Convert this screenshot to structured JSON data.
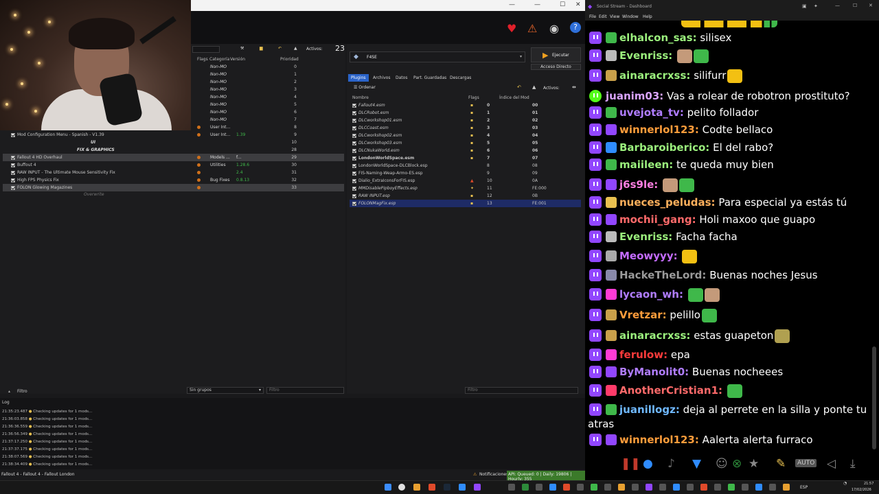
{
  "mo": {
    "toolbar": {
      "activos_label": "Activos:",
      "activos_count": "23"
    },
    "left_headers": {
      "flags": "Flags",
      "categoria": "Categoría",
      "version": "Versión",
      "prioridad": "Prioridad"
    },
    "left_rows": [
      {
        "name": "",
        "cat": "Non-MO",
        "prio": "0"
      },
      {
        "name": "",
        "cat": "Non-MO",
        "prio": "1"
      },
      {
        "name": "",
        "cat": "Non-MO",
        "prio": "2"
      },
      {
        "name": "",
        "cat": "Non-MO",
        "prio": "3"
      },
      {
        "name": "",
        "cat": "Non-MO",
        "prio": "4"
      },
      {
        "name": "",
        "cat": "Non-MO",
        "prio": "5"
      },
      {
        "name": "",
        "cat": "Non-MO",
        "prio": "6"
      },
      {
        "name": "",
        "cat": "Non-MO",
        "prio": "7"
      },
      {
        "name": "",
        "cat": "User Int...",
        "prio": "8"
      },
      {
        "name": "Mod Configuration Menu - Spanish - V1.39",
        "cat": "User Int...",
        "prio": "9",
        "ver": "1.39"
      },
      {
        "name": "UI",
        "cat": "",
        "prio": "10",
        "separator": true
      },
      {
        "name": "FIX & GRAPHICS",
        "cat": "",
        "prio": "28",
        "separator": true
      },
      {
        "name": "Fallout 4 HD Overhaul",
        "cat": "Models ...",
        "prio": "29",
        "ver": "f...",
        "selected": true
      },
      {
        "name": "Buffout 4",
        "cat": "Utilities",
        "prio": "30",
        "ver": "1.28.6"
      },
      {
        "name": "RAW INPUT - The Ultimate Mouse Sensitivity Fix",
        "cat": "",
        "prio": "31",
        "ver": "2.4"
      },
      {
        "name": "High FPS Physics Fix",
        "cat": "Bug Fixes",
        "prio": "32",
        "ver": "0.8.13"
      },
      {
        "name": "FOLON Glowing Magazines",
        "cat": "",
        "prio": "33",
        "selected": true
      }
    ],
    "overwrite": "Overwrite",
    "left_filter": {
      "label": "Filtro",
      "group": "Sin grupos",
      "placeholder": "Filtro"
    },
    "exec": {
      "profile": "F4SE",
      "run": "Ejecutar",
      "shortcut": "Acceso Directo"
    },
    "tabs": [
      "Plugins",
      "Archivos",
      "Datos",
      "Part. Guardadas",
      "Descargas"
    ],
    "right_toolbar": {
      "sort": "Ordenar",
      "activos": "Activos:"
    },
    "right_headers": {
      "name": "Nombre",
      "flags": "Flags",
      "index": "Índice del Mod"
    },
    "plugins": [
      {
        "name": "Fallout4.esm",
        "pri": "0",
        "idx": "00"
      },
      {
        "name": "DLCRobot.esm",
        "pri": "1",
        "idx": "01"
      },
      {
        "name": "DLCworkshop01.esm",
        "pri": "2",
        "idx": "02"
      },
      {
        "name": "DLCCoast.esm",
        "pri": "3",
        "idx": "03"
      },
      {
        "name": "DLCworkshop02.esm",
        "pri": "4",
        "idx": "04"
      },
      {
        "name": "DLCworkshop03.esm",
        "pri": "5",
        "idx": "05"
      },
      {
        "name": "DLCNukaWorld.esm",
        "pri": "6",
        "idx": "06"
      },
      {
        "name": "LondonWorldSpace.esm",
        "pri": "7",
        "idx": "07"
      },
      {
        "name": "LondonWorldSpace-DLCBlock.esp",
        "pri": "8",
        "idx": "08"
      },
      {
        "name": "FIS-Naming-Weap-Armo-ES.esp",
        "pri": "9",
        "idx": "09"
      },
      {
        "name": "Dialio_ExtraIconsForFIS.esp",
        "pri": "10",
        "idx": "0A"
      },
      {
        "name": "MMDisablePipboyEffects.esp",
        "pri": "11",
        "idx": "FE:000"
      },
      {
        "name": "RAW INPUT.esp",
        "pri": "12",
        "idx": "0B"
      },
      {
        "name": "FOLONMagFix.esp",
        "pri": "13",
        "idx": "FE:001",
        "selected": true
      }
    ],
    "right_filter": "Filtro",
    "log_title": "Log",
    "log": [
      {
        "time": "21:35:23.487",
        "msg": "Checking updates for 1 mods..."
      },
      {
        "time": "21:36:03.858",
        "msg": "Checking updates for 1 mods..."
      },
      {
        "time": "21:36:36.559",
        "msg": "Checking updates for 1 mods..."
      },
      {
        "time": "21:36:56.349",
        "msg": "Checking updates for 1 mods..."
      },
      {
        "time": "21:37:17.250",
        "msg": "Checking updates for 1 mods..."
      },
      {
        "time": "21:37:37.175",
        "msg": "Checking updates for 1 mods..."
      },
      {
        "time": "21:38:07.569",
        "msg": "Checking updates for 1 mods..."
      },
      {
        "time": "21:38:34.409",
        "msg": "Checking updates for 1 mods..."
      }
    ],
    "status": {
      "game": "Fallout 4 - Fallout 4 - Fallout London",
      "notif": "Notificaciones",
      "api": "API: Queued: 0 | Daily: 19806 | Hourly: 355"
    }
  },
  "ss": {
    "title": "Social Stream - Dashboard",
    "menu": [
      "File",
      "Edit",
      "View",
      "Window",
      "Help"
    ],
    "messages": [
      {
        "user": "elhalcon_sas:",
        "text": "silisex",
        "color": "#9bf07d"
      },
      {
        "user": "Evenriss:",
        "text": "",
        "color": "#9bf07d"
      },
      {
        "user": "ainaracrxss:",
        "text": "silifurr",
        "color": "#9bf07d"
      },
      {
        "user": "juanim03:",
        "text": "Vas a rolear de robotron prostituto?",
        "color": "#d9a4ff",
        "kick": true
      },
      {
        "user": "uvejota_tv:",
        "text": "pelito follador",
        "color": "#b07dff"
      },
      {
        "user": "winnerlol123:",
        "text": "Codte bellaco",
        "color": "#ff9d3b"
      },
      {
        "user": "Barbaroiberico:",
        "text": "El del rabo?",
        "color": "#9bf07d"
      },
      {
        "user": "maiileen:",
        "text": "te queda muy bien",
        "color": "#9bf07d"
      },
      {
        "user": "j6s9le:",
        "text": "",
        "color": "#ff7ee1"
      },
      {
        "user": "nueces_peludas:",
        "text": "Para especial ya estás tú",
        "color": "#ffb05c"
      },
      {
        "user": "mochii_gang:",
        "text": "Holi maxoo que guapo",
        "color": "#ff6a6a"
      },
      {
        "user": "Evenriss:",
        "text": "Facha facha",
        "color": "#9bf07d"
      },
      {
        "user": "Meowyyy:",
        "text": "",
        "color": "#c46cff"
      },
      {
        "user": "HackeTheLord:",
        "text": "Buenas noches Jesus",
        "color": "#9a9a9a"
      },
      {
        "user": "lycaon_wh:",
        "text": "",
        "color": "#b07dff"
      },
      {
        "user": "Vretzar:",
        "text": "pelillo",
        "color": "#ff9d3b"
      },
      {
        "user": "ainaracrxss:",
        "text": "estas guapeton",
        "color": "#9bf07d"
      },
      {
        "user": "ferulow:",
        "text": "epa",
        "color": "#ff3b3b"
      },
      {
        "user": "ByManolit0:",
        "text": "Buenas nocheees",
        "color": "#b07dff"
      },
      {
        "user": "AnotherCristian1:",
        "text": "",
        "color": "#ff6a6a"
      },
      {
        "user": "juanillogz:",
        "text": "deja al perrete en la silla y ponte tu",
        "cont": "atras",
        "color": "#6fb8ff"
      },
      {
        "user": "winnerlol123:",
        "text": "Aalerta alerta furraco",
        "color": "#ff9d3b"
      }
    ],
    "auto_label": "AUTO"
  },
  "taskbar": {
    "lang": "ESP",
    "time": "21:57",
    "date": "17/02/2026"
  }
}
